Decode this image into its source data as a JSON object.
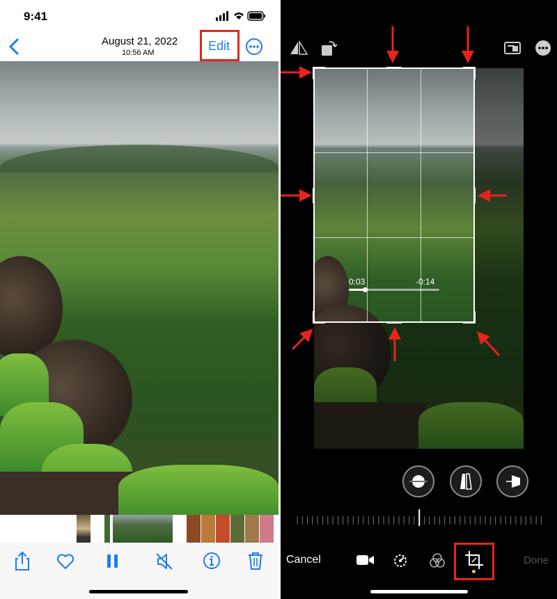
{
  "left": {
    "status_time": "9:41",
    "header_date": "August 21, 2022",
    "header_time": "10:56 AM",
    "edit_label": "Edit",
    "colors": {
      "accent": "#1a7cf5",
      "highlight": "#e8231c"
    },
    "toolbar_icons": [
      "share-icon",
      "heart-icon",
      "pause-icon",
      "mute-icon",
      "info-icon",
      "trash-icon"
    ]
  },
  "right": {
    "scrubber_start": "0:03",
    "scrubber_end": "-0:14",
    "scrubber_progress": 0.18,
    "cancel_label": "Cancel",
    "done_label": "Done",
    "colors": {
      "accent": "#f4c244",
      "highlight": "#e8231c"
    },
    "top_icons": [
      "flip-icon",
      "rotate-icon",
      "aspect-ratio-icon",
      "more-icon"
    ],
    "perspective_icons": [
      "straighten-icon",
      "vertical-perspective-icon",
      "horizontal-perspective-icon"
    ],
    "tool_icons": [
      "video-icon",
      "adjust-icon",
      "filters-icon",
      "crop-icon"
    ]
  }
}
